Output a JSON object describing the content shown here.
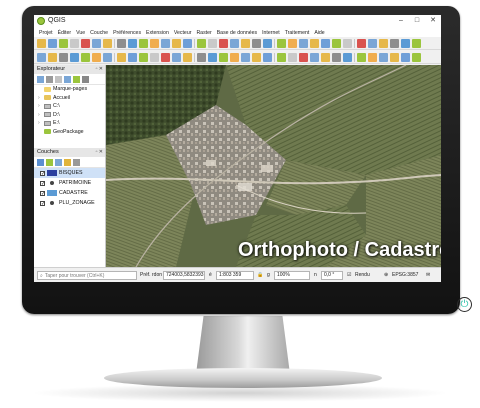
{
  "app": {
    "title": "QGIS",
    "controls": {
      "minimize": "–",
      "maximize": "□",
      "close": "✕"
    }
  },
  "menu": [
    "Projet",
    "Éditer",
    "Vue",
    "Couche",
    "Préférences",
    "Extension",
    "Vecteur",
    "Raster",
    "Base de données",
    "Internet",
    "Traitement",
    "Aide"
  ],
  "browser_panel": {
    "title": "Explorateur",
    "items": [
      {
        "label": "Marque-pages",
        "expand": ""
      },
      {
        "label": "Accueil",
        "expand": "›"
      },
      {
        "label": "C:\\",
        "expand": "›"
      },
      {
        "label": "D:\\",
        "expand": "›"
      },
      {
        "label": "E:\\",
        "expand": "›"
      },
      {
        "label": "GeoPackage",
        "expand": ""
      }
    ]
  },
  "layers_panel": {
    "title": "Couches",
    "layers": [
      {
        "name": "BISQUES",
        "checked": true,
        "swatch": "#2b3f9e",
        "selected": true
      },
      {
        "name": "PATRIMOINE",
        "checked": true,
        "swatch": "",
        "selected": false
      },
      {
        "name": "CADASTRE",
        "checked": true,
        "swatch": "#5b9bd5",
        "selected": false
      },
      {
        "name": "PLU_ZONAGE",
        "checked": true,
        "swatch": "",
        "selected": false
      }
    ]
  },
  "map": {
    "overlay_caption": "Orthophoto / Cadastre"
  },
  "statusbar": {
    "locator_placeholder": "Taper pour trouver (Ctrl+K)",
    "coordinate_label": "Préf.",
    "coordinate_prefix": "rdon",
    "coordinate_value": "724003,5832393",
    "scale_label": "é",
    "scale_value": "1:803 359",
    "zoom_label": "g",
    "zoom_value": "100%",
    "rotation_label": "n",
    "rotation_value": "0,0 °",
    "render_label": "Rendu",
    "crs": "EPSG:3857"
  },
  "colors": {
    "bezel": "#1c1c1c",
    "power_led": "#27c2a8",
    "selection": "#cfe1f7"
  }
}
